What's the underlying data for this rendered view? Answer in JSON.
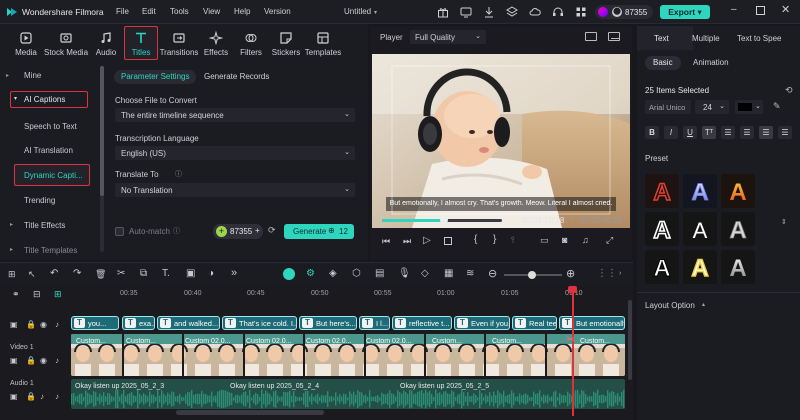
{
  "titlebar": {
    "app_name": "Wondershare Filmora",
    "menus": [
      "File",
      "Edit",
      "Tools",
      "View",
      "Help",
      "Version"
    ],
    "project_title": "Untitled",
    "credits": "87355",
    "export_label": "Export"
  },
  "toolbar": {
    "tabs": [
      "Media",
      "Stock Media",
      "Audio",
      "Titles",
      "Transitions",
      "Effects",
      "Filters",
      "Stickers",
      "Templates"
    ],
    "active": "Titles"
  },
  "leftnav": {
    "items": [
      "Mine",
      "AI Captions",
      "Speech to Text",
      "AI Translation",
      "Dynamic Capti...",
      "Trending",
      "Title Effects",
      "Title Templates"
    ]
  },
  "param": {
    "tabs": [
      "Parameter Settings",
      "Generate Records"
    ],
    "choose_label": "Choose File to Convert",
    "choose_value": "The entire timeline sequence",
    "lang_label": "Transcription Language",
    "lang_value": "English (US)",
    "translate_label": "Translate To",
    "translate_value": "No Translation",
    "automatch_label": "Auto-match",
    "credits": "87355",
    "generate_label": "Generate",
    "generate_count": "12"
  },
  "player": {
    "label": "Player",
    "quality": "Full Quality",
    "subtitle": "But emotionally, I almost cry. That's growth. Meow. Literal I almost cried.",
    "current_time": "00:01:10:18",
    "total_time": "00:02:00:05",
    "progress": 0.52
  },
  "right": {
    "tabs": [
      "Text",
      "Multiple",
      "Text to Spee"
    ],
    "subtabs": [
      "Basic",
      "Animation"
    ],
    "items_selected": "25 Items Selected",
    "font": "Arial Unico",
    "size": "24",
    "preset_label": "Preset",
    "layout_label": "Layout Option"
  },
  "timeline": {
    "ruler": [
      "00:35",
      "00:40",
      "00:45",
      "00:50",
      "00:55",
      "01:00",
      "01:05",
      "01:10"
    ],
    "captions": [
      "you...",
      "exa...",
      "and walked...",
      "That's ice cold. I...",
      "But here's...",
      "I l...",
      "reflective t...",
      "Even if you...",
      "Real tee...",
      "But emotionally..."
    ],
    "video_track_label": "Video 1",
    "audio_track_label": "Audio 1",
    "video_clips": [
      "Custom...",
      "Custom...",
      "Custom 02.0...",
      "Custom 02.0...",
      "Custom 02.0...",
      "Custom 02.0...",
      "Custom...",
      "Custom...",
      "Custom..."
    ],
    "audio_clips": [
      "Okay listen up 2025_05_2_3",
      "Okay listen up 2025_05_2_4",
      "Okay listen up 2025_05_2_5"
    ]
  },
  "colors": {
    "accent": "#2fd6bf",
    "highlight": "#e0323c",
    "caption": "#1e6b78",
    "video": "#3b8f86",
    "audio": "#2c8c76"
  }
}
